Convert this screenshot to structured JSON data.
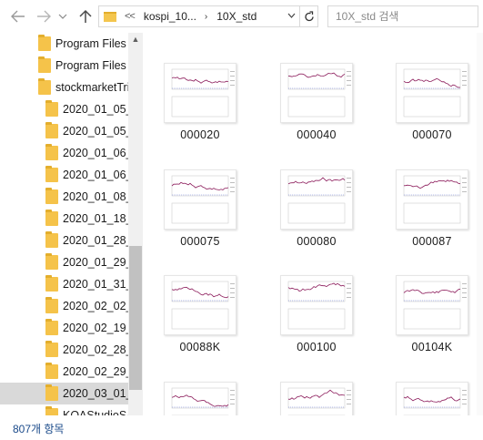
{
  "address_bar": {
    "overflow": "<<",
    "segments": [
      "kospi_10...",
      "10X_std"
    ],
    "search_placeholder": "10X_std 검색"
  },
  "nav_tree": [
    {
      "label": "Program Files",
      "indent": 1
    },
    {
      "label": "Program Files",
      "indent": 1
    },
    {
      "label": "stockmarketTri",
      "indent": 1
    },
    {
      "label": "2020_01_05_",
      "indent": 2
    },
    {
      "label": "2020_01_05_",
      "indent": 2
    },
    {
      "label": "2020_01_06_",
      "indent": 2
    },
    {
      "label": "2020_01_06_",
      "indent": 2
    },
    {
      "label": "2020_01_08_",
      "indent": 2
    },
    {
      "label": "2020_01_18_",
      "indent": 2
    },
    {
      "label": "2020_01_28_",
      "indent": 2
    },
    {
      "label": "2020_01_29_",
      "indent": 2
    },
    {
      "label": "2020_01_31_",
      "indent": 2
    },
    {
      "label": "2020_02_02_",
      "indent": 2
    },
    {
      "label": "2020_02_19_",
      "indent": 2
    },
    {
      "label": "2020_02_28_",
      "indent": 2
    },
    {
      "label": "2020_02_29_",
      "indent": 2
    },
    {
      "label": "2020_03_01_",
      "indent": 2,
      "selected": true
    },
    {
      "label": "KOAStudioSA",
      "indent": 2
    }
  ],
  "files": [
    {
      "name": "000020"
    },
    {
      "name": "000040"
    },
    {
      "name": "000070"
    },
    {
      "name": "000075"
    },
    {
      "name": "000080"
    },
    {
      "name": "000087"
    },
    {
      "name": "00088K"
    },
    {
      "name": "000100"
    },
    {
      "name": "00104K"
    },
    {
      "name": ""
    },
    {
      "name": ""
    },
    {
      "name": ""
    }
  ],
  "status": {
    "item_count": "807개 항목"
  },
  "colors": {
    "folder": "#f5c34a",
    "selection": "#d9d9d9",
    "status_text": "#1a4a8a",
    "line_series": "#8b1a5a"
  }
}
